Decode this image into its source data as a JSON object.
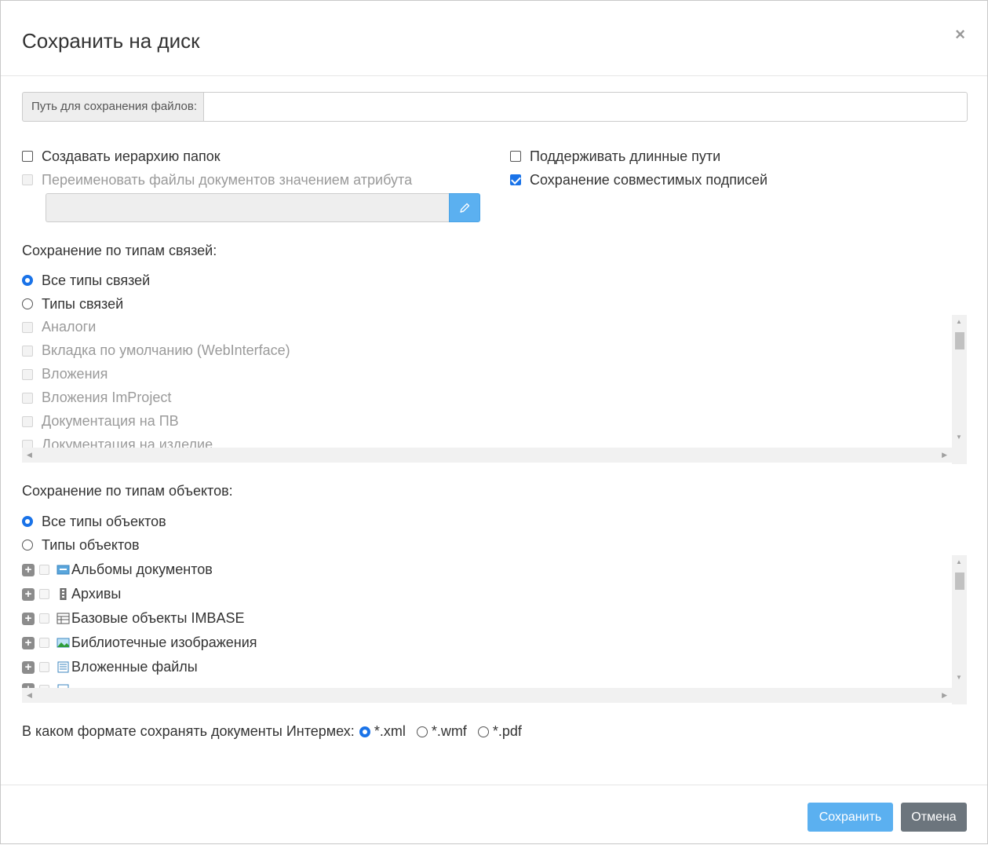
{
  "dialog": {
    "title": "Сохранить на диск",
    "close_glyph": "×"
  },
  "path": {
    "label": "Путь для сохранения файлов:",
    "value": "",
    "placeholder": ""
  },
  "options": {
    "create_hierarchy": {
      "label": "Создавать иерархию папок",
      "checked": false
    },
    "rename_files": {
      "label": "Переименовать файлы документов значением атрибута",
      "checked": false,
      "disabled": true
    },
    "long_paths": {
      "label": "Поддерживать длинные пути",
      "checked": false
    },
    "compatible_signatures": {
      "label": "Сохранение совместимых подписей",
      "checked": true
    }
  },
  "attribute": {
    "value": "",
    "edit_icon": "pencil-icon"
  },
  "link_types": {
    "section_label": "Сохранение по типам связей:",
    "all_label": "Все типы связей",
    "specific_label": "Типы связей",
    "selected": "all",
    "items": [
      "Аналоги",
      "Вкладка по умолчанию (WebInterface)",
      "Вложения",
      "Вложения ImProject",
      "Документация на ПВ",
      "Документация на изделие"
    ]
  },
  "object_types": {
    "section_label": "Сохранение по типам объектов:",
    "all_label": "Все типы объектов",
    "specific_label": "Типы объектов",
    "selected": "all",
    "items": [
      {
        "label": "Альбомы документов",
        "icon": "album-icon"
      },
      {
        "label": "Архивы",
        "icon": "archive-icon"
      },
      {
        "label": "Базовые объекты IMBASE",
        "icon": "table-icon"
      },
      {
        "label": "Библиотечные изображения",
        "icon": "image-icon"
      },
      {
        "label": "Вложенные файлы",
        "icon": "attached-file-icon"
      },
      {
        "label": "",
        "icon": "document-icon"
      }
    ]
  },
  "format": {
    "label": "В каком формате сохранять документы Интермех:",
    "options": [
      "*.xml",
      "*.wmf",
      "*.pdf"
    ],
    "selected": "*.xml"
  },
  "footer": {
    "save_label": "Сохранить",
    "cancel_label": "Отмена"
  },
  "colors": {
    "accent": "#1a73e8",
    "primary_button": "#5bb0f0",
    "secondary_button": "#6c757d"
  }
}
